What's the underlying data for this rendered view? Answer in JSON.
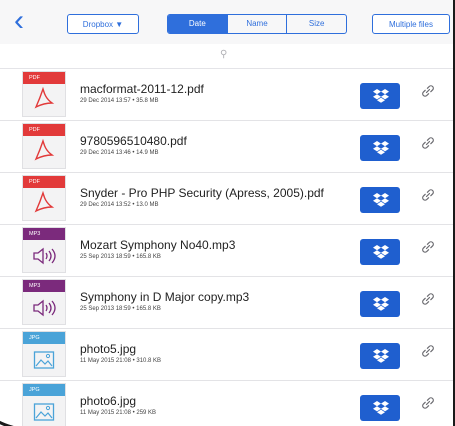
{
  "toolbar": {
    "back_icon": "chevron-left-icon",
    "dropbox_label": "Dropbox ▼",
    "sort": [
      "Date",
      "Name",
      "Size"
    ],
    "active_sort": "Date",
    "multiple_files_label": "Multiple files"
  },
  "search": {
    "icon": "search-icon"
  },
  "files": [
    {
      "type": "PDF",
      "name": "macformat-2011-12.pdf",
      "meta": "29 Dec 2014 13:57 • 35.8 MB",
      "color": "#e23a3a"
    },
    {
      "type": "PDF",
      "name": "9780596510480.pdf",
      "meta": "29 Dec 2014 13:46 • 14.9 MB",
      "color": "#e23a3a"
    },
    {
      "type": "PDF",
      "name": "Snyder - Pro PHP Security (Apress, 2005).pdf",
      "meta": "29 Dec 2014 13:52 • 13.0 MB",
      "color": "#e23a3a"
    },
    {
      "type": "MP3",
      "name": "Mozart Symphony No40.mp3",
      "meta": "25 Sep 2013 18:59 • 165.8 KB",
      "color": "#7b2a7c"
    },
    {
      "type": "MP3",
      "name": "Symphony in D Major copy.mp3",
      "meta": "25 Sep 2013 18:59 • 165.8 KB",
      "color": "#7b2a7c"
    },
    {
      "type": "JPG",
      "name": "photo5.jpg",
      "meta": "11 May 2015 21:08 • 310.8 KB",
      "color": "#4aa3d8"
    },
    {
      "type": "JPG",
      "name": "photo6.jpg",
      "meta": "11 May 2015 21:08 • 259 KB",
      "color": "#4aa3d8"
    }
  ]
}
